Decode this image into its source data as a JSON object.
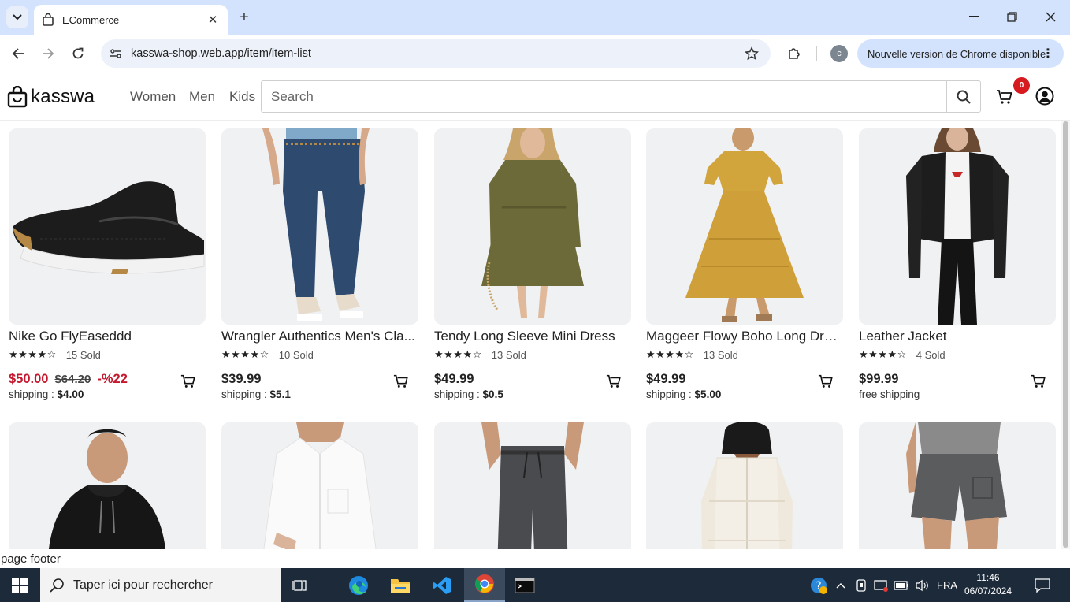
{
  "browser": {
    "tab_title": "ECommerce",
    "url": "kasswa-shop.web.app/item/item-list",
    "profile_initial": "c",
    "update_chip": "Nouvelle version de Chrome disponible"
  },
  "header": {
    "logo_text": "kasswa",
    "nav": [
      "Women",
      "Men",
      "Kids"
    ],
    "search_placeholder": "Search",
    "cart_count": "0"
  },
  "products": [
    {
      "name": "Nike Go FlyEaseddd",
      "stars": "★★★★☆",
      "sold": "15 Sold",
      "price": "$50.00",
      "old_price": "$64.20",
      "discount": "-%22",
      "shipping_label": "shipping : ",
      "shipping_value": "$4.00",
      "icon": "shoe-image"
    },
    {
      "name": "Wrangler Authentics Men's Cla...",
      "stars": "★★★★☆",
      "sold": "10 Sold",
      "price": "$39.99",
      "shipping_label": "shipping : ",
      "shipping_value": "$5.1",
      "icon": "jeans-image"
    },
    {
      "name": "Tendy Long Sleeve Mini Dress",
      "stars": "★★★★☆",
      "sold": "13 Sold",
      "price": "$49.99",
      "shipping_label": "shipping : ",
      "shipping_value": "$0.5",
      "icon": "dress-image"
    },
    {
      "name": "Maggeer Flowy Boho Long Dress",
      "stars": "★★★★☆",
      "sold": "13 Sold",
      "price": "$49.99",
      "shipping_label": "shipping : ",
      "shipping_value": "$5.00",
      "icon": "long-dress-image"
    },
    {
      "name": "Leather Jacket",
      "stars": "★★★★☆",
      "sold": "4 Sold",
      "price": "$99.99",
      "shipping_label": "free shipping",
      "shipping_value": "",
      "icon": "jacket-image"
    }
  ],
  "row2_products": [
    {
      "icon": "hoodie-image"
    },
    {
      "icon": "shirt-image"
    },
    {
      "icon": "joggers-image"
    },
    {
      "icon": "puffer-coat-image"
    },
    {
      "icon": "shorts-image"
    }
  ],
  "footer": {
    "text": "page footer"
  },
  "taskbar": {
    "search_placeholder": "Taper ici pour rechercher",
    "language": "FRA",
    "time": "11:46",
    "date": "06/07/2024"
  },
  "colors": {
    "sale": "#c5172e",
    "badge": "#d71920",
    "taskbar": "#1c2a3a"
  }
}
